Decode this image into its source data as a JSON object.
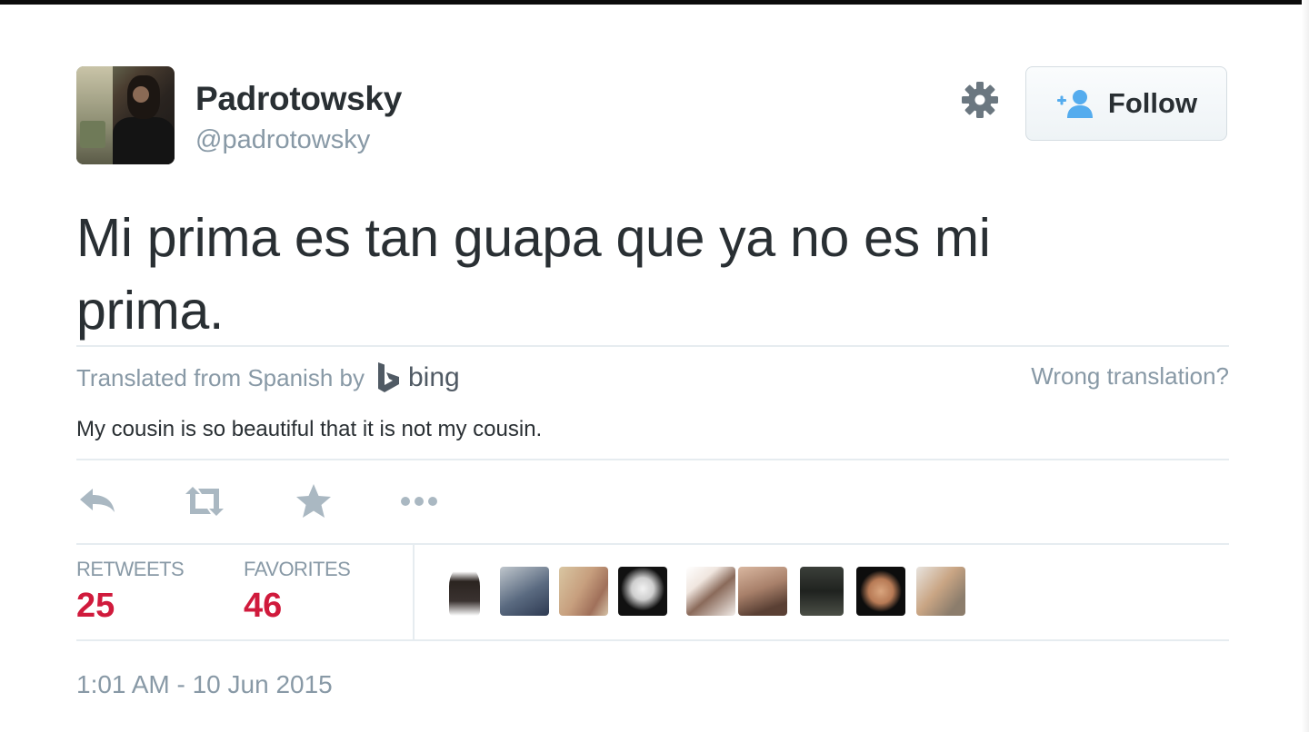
{
  "user": {
    "full_name": "Padrotowsky",
    "screen_name": "@padrotowsky"
  },
  "follow_button": {
    "label": "Follow"
  },
  "tweet": {
    "text": "Mi prima es tan guapa que ya no es mi prima.",
    "translated_prefix": "Translated from Spanish by",
    "translator": "bing",
    "wrong_translation_label": "Wrong translation?",
    "translation": "My cousin is so beautiful that it is not my cousin."
  },
  "actions": {
    "icons": [
      "reply-icon",
      "retweet-icon",
      "favorite-icon",
      "more-icon"
    ]
  },
  "stats": {
    "retweets_label": "RETWEETS",
    "retweets_value": "25",
    "favorites_label": "FAVORITES",
    "favorites_value": "46"
  },
  "favoriters": [
    "favoriter-avatar",
    "favoriter-avatar",
    "favoriter-avatar",
    "favoriter-avatar",
    "favoriter-avatar",
    "favoriter-avatar",
    "favoriter-avatar",
    "favoriter-avatar",
    "favoriter-avatar"
  ],
  "timestamp": "1:01 AM - 10 Jun 2015",
  "colors": {
    "text": "#292f33",
    "muted": "#8899a6",
    "accent_blue": "#55acee",
    "count_red": "#d01a3c",
    "divider": "#e6ecf0"
  }
}
